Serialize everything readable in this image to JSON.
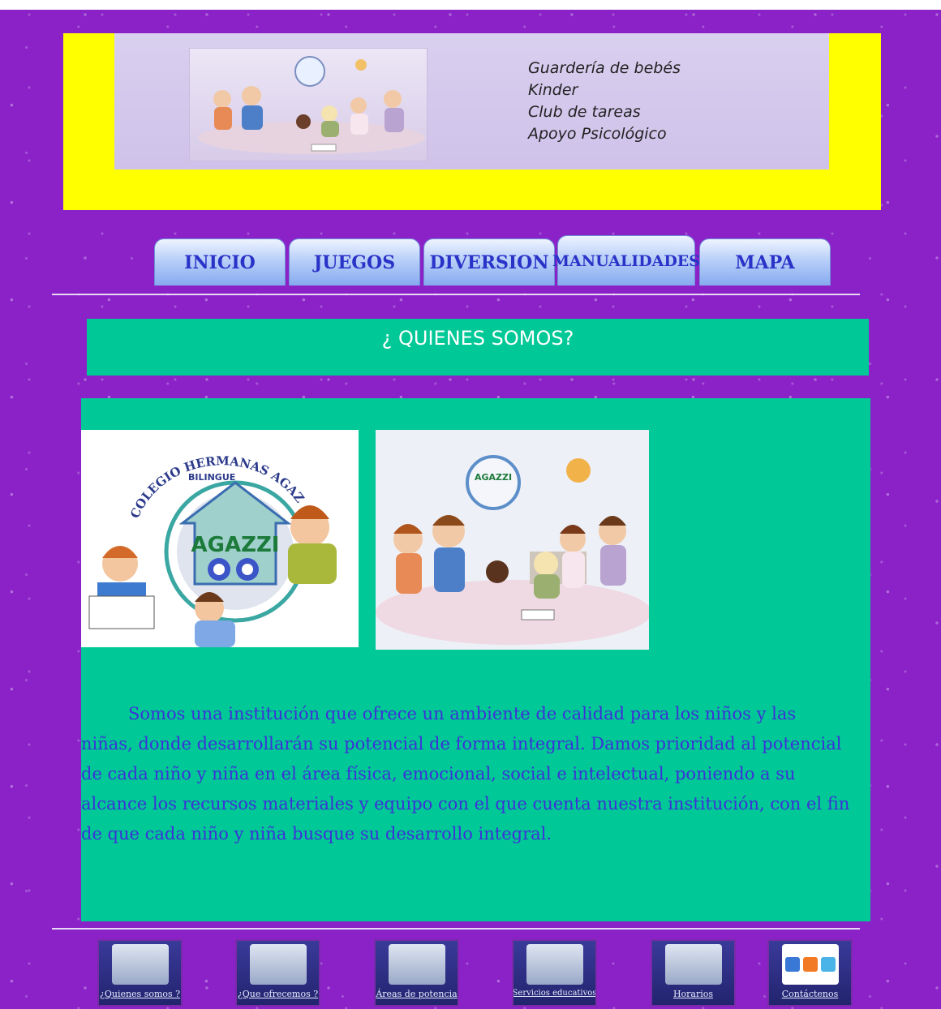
{
  "header": {
    "services": [
      "Guardería de bebés",
      "Kinder",
      "Club de tareas",
      "Apoyo Psicológico"
    ]
  },
  "nav": {
    "tabs": [
      {
        "label": "INICIO"
      },
      {
        "label": "JUEGOS"
      },
      {
        "label": "DIVERSION"
      },
      {
        "label": "MANUALIDADES"
      },
      {
        "label": "MAPA"
      }
    ]
  },
  "main": {
    "title": "¿ QUIENES SOMOS?",
    "logo_text": "COLEGIO HERMANAS AGAZZI",
    "logo_subtext": "BILINGUE",
    "logo_brand": "AGAZZI",
    "paragraph": "Somos una institución que ofrece un ambiente de calidad para los niños y las niñas, donde desarrollarán su potencial de forma integral. Damos prioridad al potencial de cada niño y niña en el área física, emocional, social e intelectual, poniendo a su alcance los recursos materiales y equipo con el que cuenta nuestra institución, con el fin de que cada niño y niña busque su desarrollo integral."
  },
  "footer": {
    "buttons": [
      {
        "label": "¿Quienes somos ?"
      },
      {
        "label": "¿Que ofrecemos ?"
      },
      {
        "label": "Áreas de potencia"
      },
      {
        "label": "Servicios educativos"
      },
      {
        "label": "Horarios"
      },
      {
        "label": "Contáctenos"
      }
    ]
  },
  "colors": {
    "background": "#8b22c8",
    "header_bg": "#ffff00",
    "content_bg": "#00c896",
    "paragraph_text": "#3d31d8",
    "tab_text": "#2a33c8"
  }
}
